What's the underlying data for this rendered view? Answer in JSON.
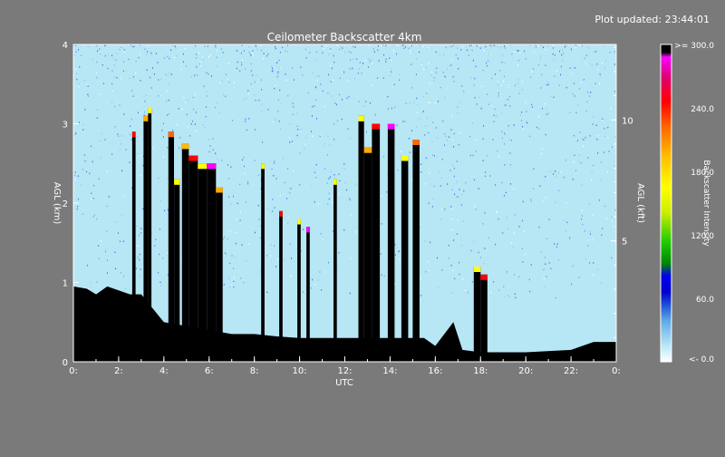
{
  "updated_label": "Plot updated: 23:44:01",
  "chart_data": {
    "type": "heatmap",
    "title": "Ceilometer Backscatter 4km",
    "xlabel": "UTC",
    "ylabel_left": "AGL (km)",
    "ylabel_right": "AGL (kft)",
    "x_range_hours": [
      0,
      24
    ],
    "y_range_km": [
      0,
      4
    ],
    "x_ticks": [
      {
        "hour": 0,
        "label": "0:"
      },
      {
        "hour": 2,
        "label": "2:"
      },
      {
        "hour": 4,
        "label": "4:"
      },
      {
        "hour": 6,
        "label": "6:"
      },
      {
        "hour": 8,
        "label": "8:"
      },
      {
        "hour": 10,
        "label": "10:"
      },
      {
        "hour": 12,
        "label": "12:"
      },
      {
        "hour": 14,
        "label": "14:"
      },
      {
        "hour": 16,
        "label": "16:"
      },
      {
        "hour": 18,
        "label": "18:"
      },
      {
        "hour": 20,
        "label": "20:"
      },
      {
        "hour": 22,
        "label": "22:"
      },
      {
        "hour": 24,
        "label": "0:"
      }
    ],
    "y_ticks_km": [
      {
        "value": 0,
        "label": "0"
      },
      {
        "value": 1,
        "label": "1"
      },
      {
        "value": 2,
        "label": "2"
      },
      {
        "value": 3,
        "label": "3"
      },
      {
        "value": 4,
        "label": "4"
      }
    ],
    "y_ticks_kft": [
      {
        "value": 5,
        "label": "5"
      },
      {
        "value": 10,
        "label": "10"
      }
    ],
    "colorbar": {
      "title": "Backscatter Intensity",
      "range": [
        0,
        300
      ],
      "ticks": [
        {
          "value": 0,
          "label": "<-  0.0"
        },
        {
          "value": 60,
          "label": "60.0"
        },
        {
          "value": 120,
          "label": "120.0"
        },
        {
          "value": 180,
          "label": "180.0"
        },
        {
          "value": 240,
          "label": "240.0"
        },
        {
          "value": 300,
          "label": ">= 300.0"
        }
      ],
      "colors": [
        "#ffffff",
        "#b9e8f7",
        "#5fa8e6",
        "#1e4fd8",
        "#0000cc",
        "#008800",
        "#22cc00",
        "#ccee00",
        "#ffff00",
        "#ffbb00",
        "#ff6600",
        "#ff0000",
        "#dd0077",
        "#ff00ff",
        "#000000"
      ]
    },
    "features": {
      "boundary_layer_km": [
        [
          0.0,
          0.95
        ],
        [
          0.6,
          0.92
        ],
        [
          1.0,
          0.85
        ],
        [
          1.5,
          0.95
        ],
        [
          2.0,
          0.9
        ],
        [
          2.5,
          0.85
        ],
        [
          3.0,
          0.85
        ],
        [
          4.0,
          0.5
        ],
        [
          5.0,
          0.45
        ],
        [
          6.0,
          0.4
        ],
        [
          7.0,
          0.35
        ],
        [
          8.0,
          0.35
        ],
        [
          9.0,
          0.32
        ],
        [
          10.0,
          0.3
        ],
        [
          11.0,
          0.3
        ],
        [
          12.0,
          0.3
        ],
        [
          13.0,
          0.3
        ],
        [
          14.0,
          0.3
        ],
        [
          15.0,
          0.3
        ],
        [
          15.5,
          0.3
        ],
        [
          16.0,
          0.2
        ],
        [
          16.8,
          0.5
        ],
        [
          17.2,
          0.15
        ],
        [
          18.0,
          0.12
        ],
        [
          20.0,
          0.12
        ],
        [
          22.0,
          0.15
        ],
        [
          23.0,
          0.25
        ],
        [
          24.0,
          0.25
        ]
      ],
      "cloud_columns": [
        {
          "start": 2.6,
          "end": 2.75,
          "top_km": 2.9,
          "color": "#ff0000"
        },
        {
          "start": 3.1,
          "end": 3.3,
          "top_km": 3.1,
          "color": "#ffaa00"
        },
        {
          "start": 3.3,
          "end": 3.45,
          "top_km": 3.2,
          "color": "#ffff00"
        },
        {
          "start": 4.2,
          "end": 4.45,
          "top_km": 2.9,
          "color": "#ff6600"
        },
        {
          "start": 4.45,
          "end": 4.7,
          "top_km": 2.3,
          "color": "#ffff00"
        },
        {
          "start": 4.8,
          "end": 5.1,
          "top_km": 2.75,
          "color": "#ffbb00"
        },
        {
          "start": 5.1,
          "end": 5.5,
          "top_km": 2.6,
          "color": "#ff0000"
        },
        {
          "start": 5.5,
          "end": 5.9,
          "top_km": 2.5,
          "color": "#ffff00"
        },
        {
          "start": 5.9,
          "end": 6.3,
          "top_km": 2.5,
          "color": "#ff00ff"
        },
        {
          "start": 6.3,
          "end": 6.6,
          "top_km": 2.2,
          "color": "#ffaa00"
        },
        {
          "start": 8.3,
          "end": 8.45,
          "top_km": 2.5,
          "color": "#ffff00"
        },
        {
          "start": 9.1,
          "end": 9.25,
          "top_km": 1.9,
          "color": "#ff0000"
        },
        {
          "start": 9.9,
          "end": 10.05,
          "top_km": 1.8,
          "color": "#ffff00"
        },
        {
          "start": 10.3,
          "end": 10.45,
          "top_km": 1.7,
          "color": "#ff00ff"
        },
        {
          "start": 11.5,
          "end": 11.65,
          "top_km": 2.3,
          "color": "#ffff00"
        },
        {
          "start": 12.6,
          "end": 12.85,
          "top_km": 3.1,
          "color": "#ffff00"
        },
        {
          "start": 12.85,
          "end": 13.2,
          "top_km": 2.7,
          "color": "#ffaa00"
        },
        {
          "start": 13.2,
          "end": 13.55,
          "top_km": 3.0,
          "color": "#ff0000"
        },
        {
          "start": 13.9,
          "end": 14.2,
          "top_km": 3.0,
          "color": "#ff00ff"
        },
        {
          "start": 14.5,
          "end": 14.8,
          "top_km": 2.6,
          "color": "#ffff00"
        },
        {
          "start": 15.0,
          "end": 15.3,
          "top_km": 2.8,
          "color": "#ff6600"
        },
        {
          "start": 17.7,
          "end": 18.0,
          "top_km": 1.2,
          "color": "#ffff00"
        },
        {
          "start": 18.0,
          "end": 18.3,
          "top_km": 1.1,
          "color": "#ff0000"
        }
      ]
    }
  }
}
